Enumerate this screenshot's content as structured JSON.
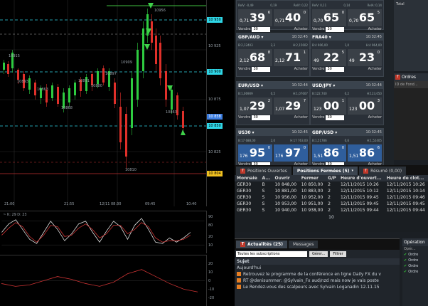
{
  "chart": {
    "price_labels": [
      "10 950",
      "10 925",
      "10 900",
      "10 875",
      "10 858",
      "10 850",
      "10 825",
      "10 804"
    ],
    "time_labels": [
      "21:00",
      "21:55",
      "12/11 08:30",
      "09:45",
      "10:40"
    ],
    "annotations": [
      "10956",
      "10915",
      "10909",
      "10897",
      "10893",
      "10891",
      "10880",
      "10868",
      "10863",
      "10863",
      "10810"
    ],
    "stoch_header": "~ K: 29 D: 23",
    "stoch_levels": [
      "90",
      "80",
      "20",
      "10"
    ],
    "macd_levels": [
      "20",
      "10",
      "0",
      "-10",
      "-20"
    ]
  },
  "tiles": [
    {
      "name": "",
      "time": "",
      "bid_big": "39",
      "bid_small": "0,71",
      "bid_sup": "6",
      "ask_big": "40",
      "ask_small": "0,71",
      "ask_sup": "0",
      "bs": [
        "RelV: -0,49",
        "0,19",
        "RelV: 0,22"
      ],
      "qty": "30",
      "sell": "Vendre",
      "buy": "Acheter"
    },
    {
      "name": "",
      "time": "",
      "bid_big": "65",
      "bid_small": "0,70",
      "bid_sup": "0",
      "ask_big": "65",
      "ask_small": "0,70",
      "ask_sup": "5",
      "bs": [
        "RelV: 0,11",
        "0,14",
        "RelA: 0,14"
      ],
      "qty": "30",
      "sell": "Vendre",
      "buy": "Acheter"
    },
    {
      "name": "GBP/AUD",
      "time": "10:32:45",
      "bid_big": "68",
      "bid_small": "2,12",
      "bid_sup": "8",
      "ask_big": "71",
      "ask_small": "2,12",
      "ask_sup": "1",
      "bs": [
        "B:2,12403",
        "2,3",
        "H:2,15602"
      ],
      "qty": "30",
      "sell": "Vendre",
      "buy": "Acheter"
    },
    {
      "name": "FRA40",
      "time": "10:32:45",
      "bid_big": "22",
      "bid_small": "49",
      "bid_sup": "5",
      "ask_big": "23",
      "ask_small": "49",
      "ask_sup": "0",
      "bs": [
        "B:4 906,00",
        "1,0",
        "H:4 964,00"
      ],
      "qty": "30",
      "sell": "Vendre",
      "buy": "Acheter"
    },
    {
      "name": "EUR/USD",
      "time": "10:32:44",
      "bid_big": "29",
      "bid_small": "1,07",
      "bid_sup": "2",
      "ask_big": "29",
      "ask_small": "1,07",
      "ask_sup": "7",
      "bs": [
        "B:1,06909",
        "0,5",
        "H:1,07607"
      ],
      "qty": "30",
      "sell": "Vendre",
      "buy": "Acheter"
    },
    {
      "name": "USD/JPY",
      "time": "10:32:44",
      "bid_big": "00",
      "bid_small": "123",
      "bid_sup": "1",
      "ask_big": "00",
      "ask_small": "123",
      "ask_sup": "3",
      "bs": [
        "B:122,740",
        "0,2",
        "H:123,050"
      ],
      "qty": "30",
      "sell": "Vendre",
      "buy": "Acheter"
    },
    {
      "name": "US30",
      "time": "10:32:45",
      "bid_big": "95",
      "bid_small": "176",
      "bid_sup": "0",
      "ask_big": "97",
      "ask_small": "176",
      "ask_sup": "0",
      "bs": [
        "B:17 688,00",
        "2,0",
        "H:17 763,00"
      ],
      "qty": "30",
      "sell": "Vendre",
      "buy": "Acheter"
    },
    {
      "name": "GBP/USD",
      "time": "10:32:45",
      "bid_big": "86",
      "bid_small": "1,51",
      "bid_sup": "0",
      "ask_big": "86",
      "ask_small": "1,51",
      "ask_sup": "6",
      "bs": [
        "B:1,51786",
        "0,6",
        "H:1,52405"
      ],
      "qty": "30",
      "sell": "Vendre",
      "buy": "Acheter"
    }
  ],
  "tabs": [
    {
      "label": "Positions Ouvertes"
    },
    {
      "label": "Positions Fermées (5)"
    },
    {
      "label": "Résumé (0,00)"
    }
  ],
  "positions": {
    "headers": [
      "Monnaie",
      "A...",
      "Ouvrir",
      "Fermer",
      "G/P",
      "Heure d'ouvert...",
      "Heure de clot..."
    ],
    "rows": [
      [
        "GER30",
        "B",
        "10 848,00",
        "10 850,00",
        "2",
        "12/11/2015 10:26",
        "12/11/2015 10:26"
      ],
      [
        "GER30",
        "S",
        "10 881,00",
        "10 883,00",
        "2",
        "12/11/2015 10:12",
        "12/11/2015 10:14"
      ],
      [
        "GER30",
        "S",
        "10 956,00",
        "10 952,00",
        "2",
        "12/11/2015 09:45",
        "12/11/2015 09:46"
      ],
      [
        "GER30",
        "S",
        "10 953,00",
        "10 951,00",
        "2",
        "12/11/2015 09:45",
        "12/11/2015 09:45"
      ],
      [
        "GER30",
        "S",
        "10 940,00",
        "10 938,00",
        "2",
        "12/11/2015 09:44",
        "12/11/2015 09:44"
      ]
    ],
    "total": "10"
  },
  "right_top": {
    "label": "Total"
  },
  "orders": {
    "title": "Ordres",
    "col": "ID de Fond..."
  },
  "news": {
    "tab1": "Actualités (25)",
    "tab2": "Messages",
    "filter": "Toutes les subscriptions",
    "btn1": "Gérer...",
    "btn2": "Filtrer",
    "col": "Sujet",
    "day": "Aujourd'hui",
    "items": [
      "Retrouvez le programme de la conférence en ligne Daily FX du v",
      "RT @denisummer: @Sylvain_Fx aud/nzd mais now je vais poste",
      "Le Rendez-vous des scalpeurs avec Sylvain Loganadin 12.11.15"
    ]
  },
  "ops": {
    "title": "Opération",
    "col": "Opér...",
    "items": [
      "Ordre",
      "Ordre",
      "Ordre",
      "Ordre"
    ]
  }
}
